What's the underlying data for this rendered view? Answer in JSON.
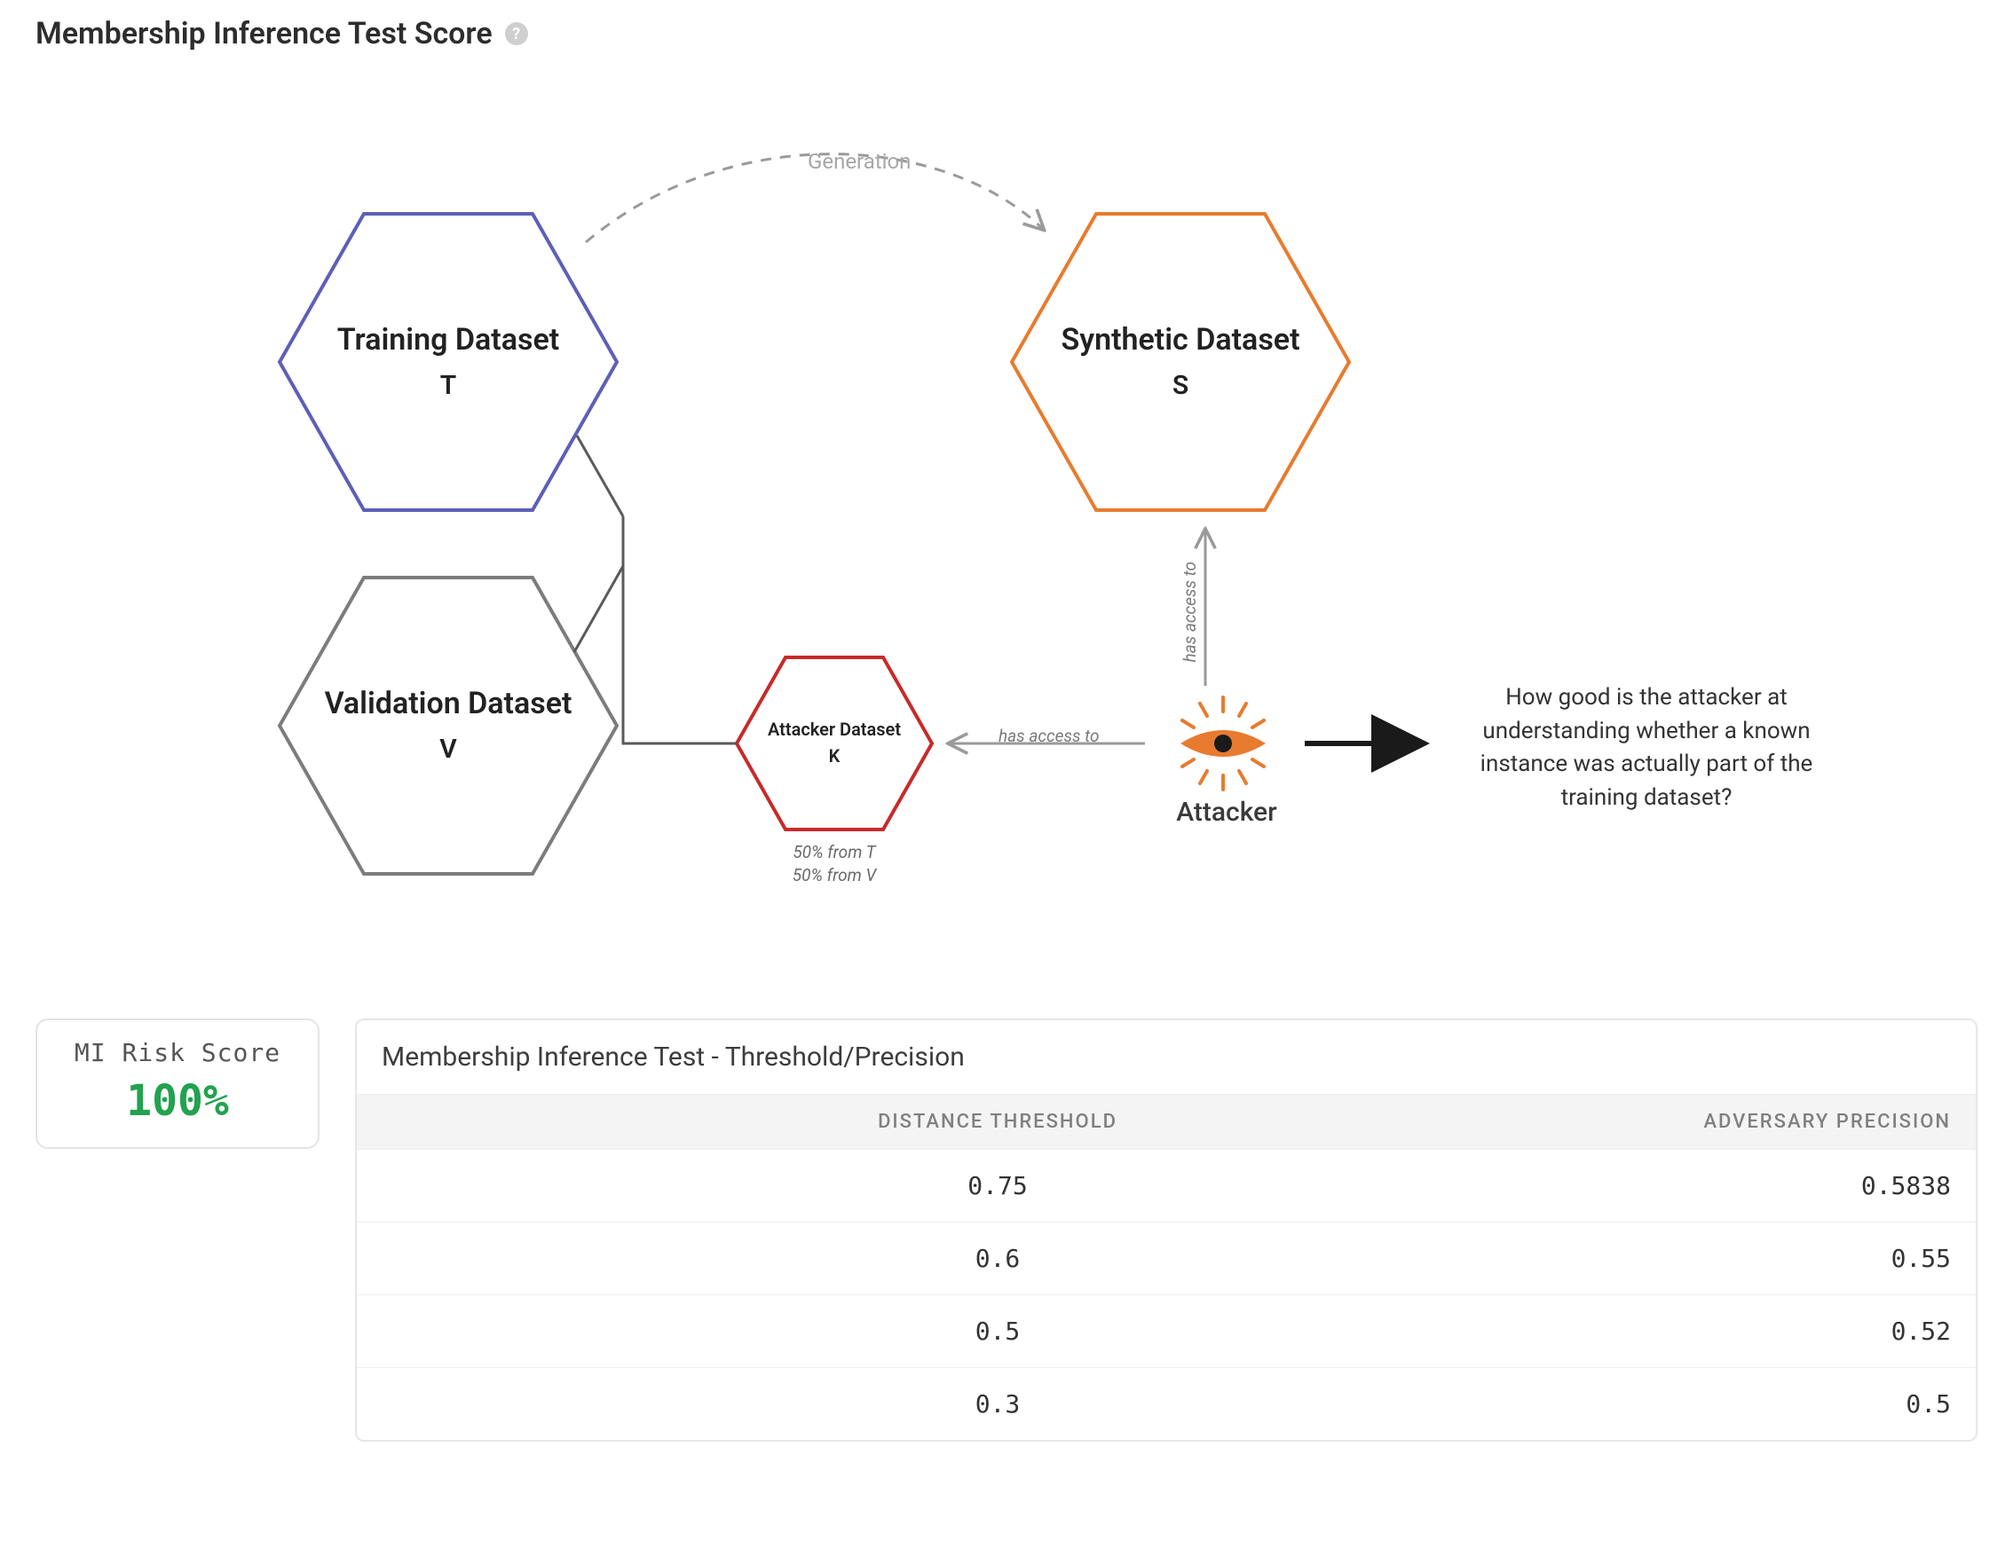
{
  "title": "Membership Inference Test Score",
  "help_glyph": "?",
  "diagram": {
    "training": {
      "name": "Training Dataset",
      "letter": "T"
    },
    "validation": {
      "name": "Validation Dataset",
      "letter": "V"
    },
    "synthetic": {
      "name": "Synthetic Dataset",
      "letter": "S"
    },
    "attacker_ds": {
      "name": "Attacker Dataset",
      "letter": "K"
    },
    "attacker_label": "Attacker",
    "generation_label": "Generation",
    "access_to_s": "has access to",
    "access_to_k": "has access to",
    "composition_line1": "50%  from T",
    "composition_line2": "50%  from V",
    "question": "How good is the attacker at understanding whether a known instance was actually part of the training dataset?"
  },
  "score": {
    "title": "MI Risk Score",
    "value": "100%"
  },
  "table": {
    "title": "Membership Inference Test - Threshold/Precision",
    "col_threshold": "DISTANCE THRESHOLD",
    "col_precision": "ADVERSARY PRECISION",
    "rows": [
      {
        "threshold": "0.75",
        "precision": "0.5838"
      },
      {
        "threshold": "0.6",
        "precision": "0.55"
      },
      {
        "threshold": "0.5",
        "precision": "0.52"
      },
      {
        "threshold": "0.3",
        "precision": "0.5"
      }
    ]
  },
  "colors": {
    "training": "#5d5fb8",
    "validation": "#7c7c7c",
    "synthetic": "#e87b2f",
    "attacker_ds": "#c82a2a",
    "arrow_gray": "#9a9a9a",
    "arrow_dark": "#1a1a1a"
  }
}
